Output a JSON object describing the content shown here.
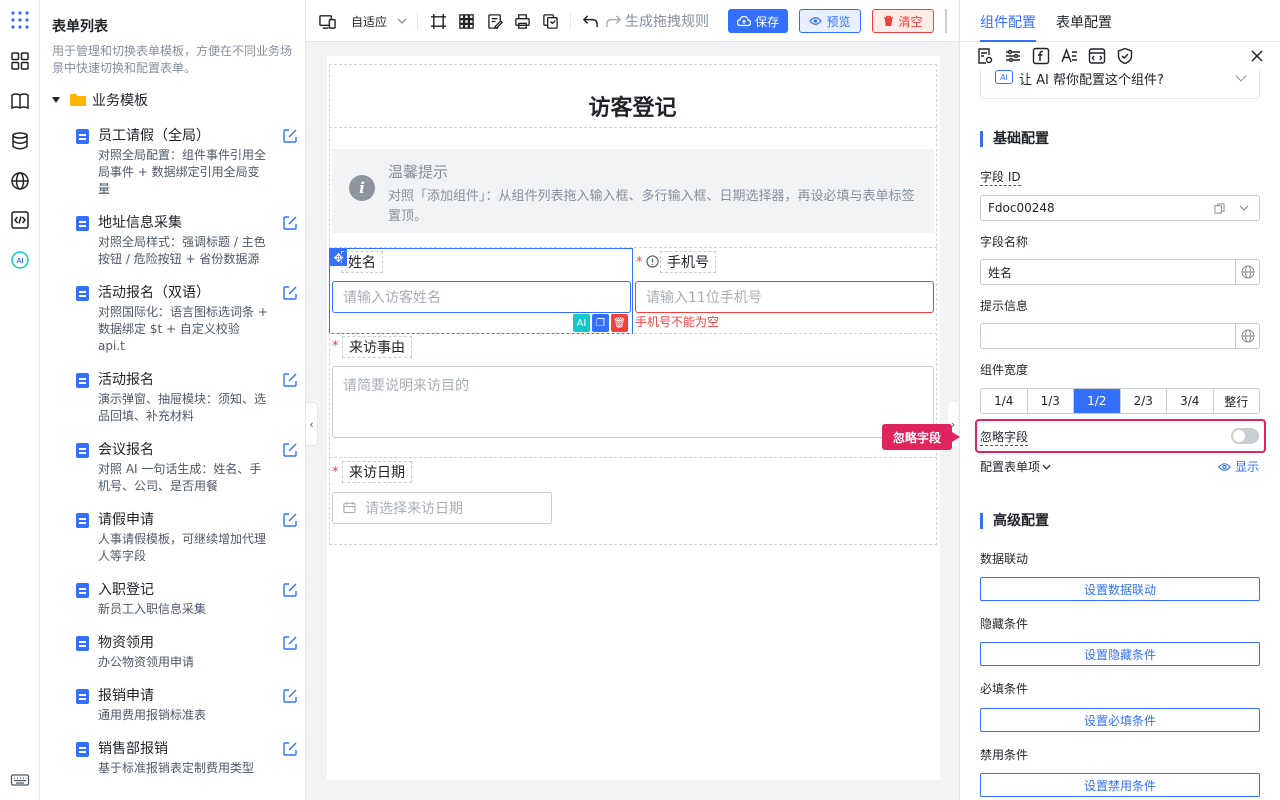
{
  "list": {
    "title": "表单列表",
    "description": "用于管理和切换表单模板，方便在不同业务场景中快速切换和配置表单。",
    "folder": "业务模板",
    "items": [
      {
        "name": "员工请假（全局）",
        "desc": "对照全局配置：组件事件引用全局事件 + 数据绑定引用全局变量"
      },
      {
        "name": "地址信息采集",
        "desc": "对照全局样式：强调标题 / 主色按钮 / 危险按钮 + 省份数据源"
      },
      {
        "name": "活动报名（双语）",
        "desc": "对照国际化：语言图标选词条 + 数据绑定 $t + 自定义校验 api.t"
      },
      {
        "name": "活动报名",
        "desc": "演示弹窗、抽屉模块：须知、选品回填、补充材料"
      },
      {
        "name": "会议报名",
        "desc": "对照 AI 一句话生成：姓名、手机号、公司、是否用餐"
      },
      {
        "name": "请假申请",
        "desc": "人事请假模板，可继续增加代理人等字段"
      },
      {
        "name": "入职登记",
        "desc": "新员工入职信息采集"
      },
      {
        "name": "物资领用",
        "desc": "办公物资领用申请"
      },
      {
        "name": "报销申请",
        "desc": "通用费用报销标准表"
      },
      {
        "name": "销售部报销",
        "desc": "基于标准报销表定制费用类型"
      }
    ]
  },
  "toolbar": {
    "layout_mode": "自适应",
    "rule_label": "生成拖拽规则",
    "save": "保存",
    "preview": "预览",
    "clear": "清空"
  },
  "form": {
    "title": "访客登记",
    "tip_title": "温馨提示",
    "tip_text": "对照「添加组件」：从组件列表拖入输入框、多行输入框、日期选择器，再设必填与表单标签置顶。",
    "fields": {
      "name_label": "姓名",
      "name_placeholder": "请输入访客姓名",
      "phone_label": "手机号",
      "phone_placeholder": "请输入11位手机号",
      "phone_error": "手机号不能为空",
      "reason_label": "来访事由",
      "reason_placeholder": "请简要说明来访目的",
      "date_label": "来访日期",
      "date_placeholder": "请选择来访日期"
    },
    "required_mark": "*"
  },
  "panel": {
    "tabs": [
      "组件配置",
      "表单配置"
    ],
    "ai_prompt": "让 AI 帮你配置这个组件?",
    "ai_badge": "AI",
    "basic_title": "基础配置",
    "field_id_label": "字段 ID",
    "field_id_value": "Fdoc00248",
    "field_name_label": "字段名称",
    "field_name_value": "姓名",
    "hint_label": "提示信息",
    "width_label": "组件宽度",
    "widths": [
      "1/4",
      "1/3",
      "1/2",
      "2/3",
      "3/4",
      "整行"
    ],
    "width_selected": "1/2",
    "ignore_label": "忽略字段",
    "ignore_on": false,
    "options_label": "配置表单项",
    "show_label": "显示",
    "advanced_title": "高级配置",
    "linkage_label": "数据联动",
    "linkage_btn": "设置数据联动",
    "hidden_label": "隐藏条件",
    "hidden_btn": "设置隐藏条件",
    "required_label": "必填条件",
    "required_btn": "设置必填条件",
    "disabled_label": "禁用条件",
    "disabled_btn": "设置禁用条件"
  },
  "callout": "忽略字段",
  "colors": {
    "primary": "#3370ff",
    "danger": "#f53f3f",
    "highlight": "#e0245e"
  }
}
